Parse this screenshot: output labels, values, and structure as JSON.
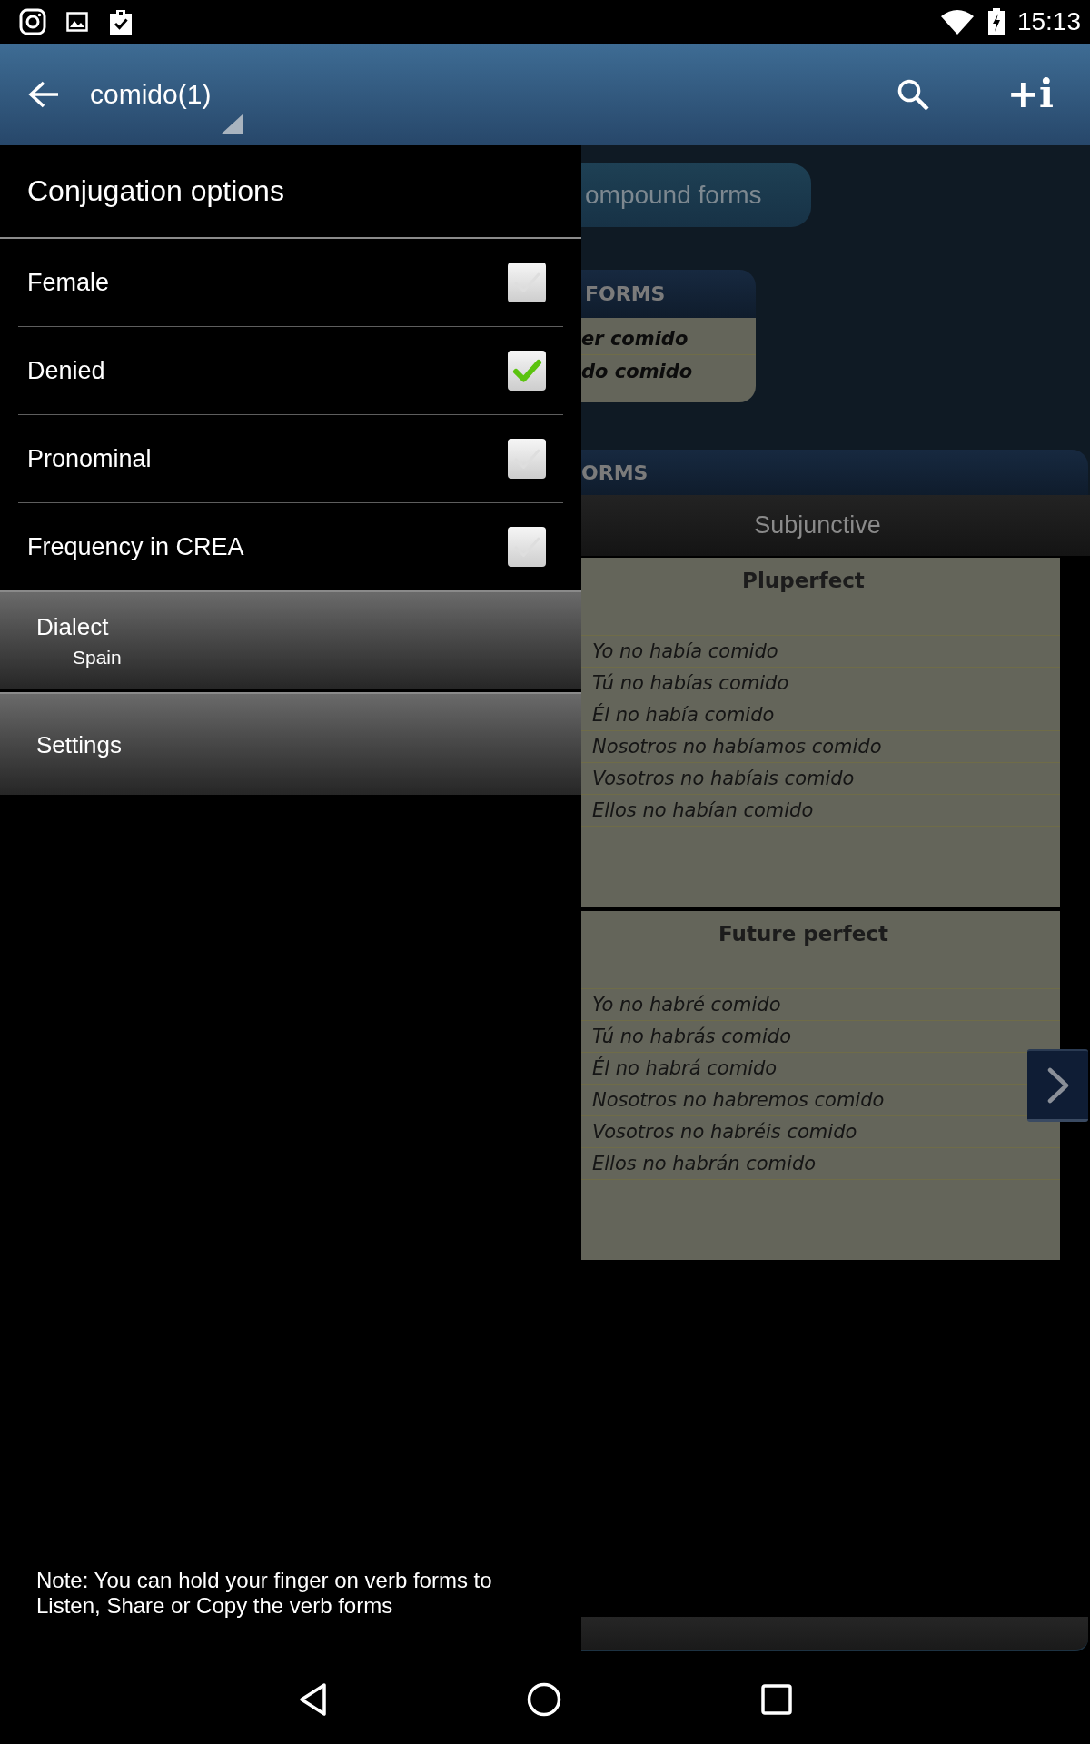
{
  "status_bar": {
    "time": "15:13"
  },
  "app_bar": {
    "title": "comido(1)",
    "info_button": "+i"
  },
  "conjugation": {
    "compound_button": "ompound forms",
    "forms_box": {
      "header": "FORMS",
      "rows": [
        "er comido",
        "do comido"
      ]
    },
    "section_header": "ORMS",
    "tab": "Subjunctive",
    "cards": [
      {
        "title": "Pluperfect",
        "rows": [
          "Yo no había comido",
          "Tú no habías comido",
          "Él no había comido",
          "Nosotros no habíamos comido",
          "Vosotros no habíais comido",
          "Ellos no habían comido"
        ]
      },
      {
        "title": "Future perfect",
        "rows": [
          "Yo no habré comido",
          "Tú no habrás comido",
          "Él no habrá comido",
          "Nosotros no habremos comido",
          "Vosotros no habréis comido",
          "Ellos no habrán comido"
        ]
      }
    ]
  },
  "drawer": {
    "title": "Conjugation options",
    "options": [
      {
        "label": "Female",
        "checked": false
      },
      {
        "label": "Denied",
        "checked": true
      },
      {
        "label": "Pronominal",
        "checked": false
      },
      {
        "label": "Frequency in CREA",
        "checked": false
      }
    ],
    "menu": [
      {
        "label": "Dialect",
        "value": "Spain"
      },
      {
        "label": "Settings"
      }
    ],
    "note": "Note: You can hold your finger on verb forms to Listen, Share or Copy the verb forms"
  }
}
